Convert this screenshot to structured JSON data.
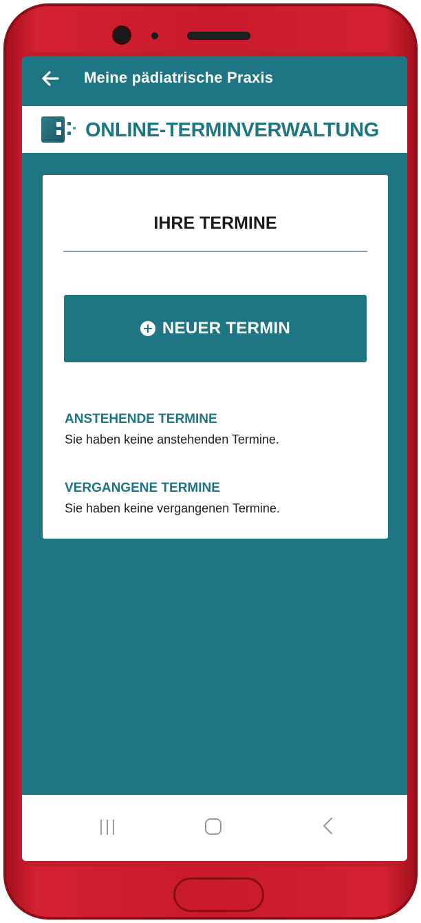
{
  "app_bar": {
    "title": "Meine pädiatrische Praxis",
    "back_icon": "arrow-left-icon"
  },
  "brand": {
    "name": "ONLINE-TERMINVERWALTUNG",
    "logo_icon": "calendar-logo-icon"
  },
  "card": {
    "title": "IHRE TERMINE",
    "new_button_label": "NEUER TERMIN",
    "new_button_icon": "plus-circle-icon",
    "sections": [
      {
        "title": "ANSTEHENDE TERMINE",
        "text": "Sie haben keine anstehenden Termine."
      },
      {
        "title": "VERGANGENE TERMINE",
        "text": "Sie haben keine vergangenen Termine."
      }
    ]
  },
  "navigation": {
    "icons": [
      "recent-apps-icon",
      "home-icon",
      "back-icon"
    ]
  },
  "colors": {
    "primary": "#1e7583",
    "device": "#c81a2b",
    "card": "#ffffff"
  }
}
